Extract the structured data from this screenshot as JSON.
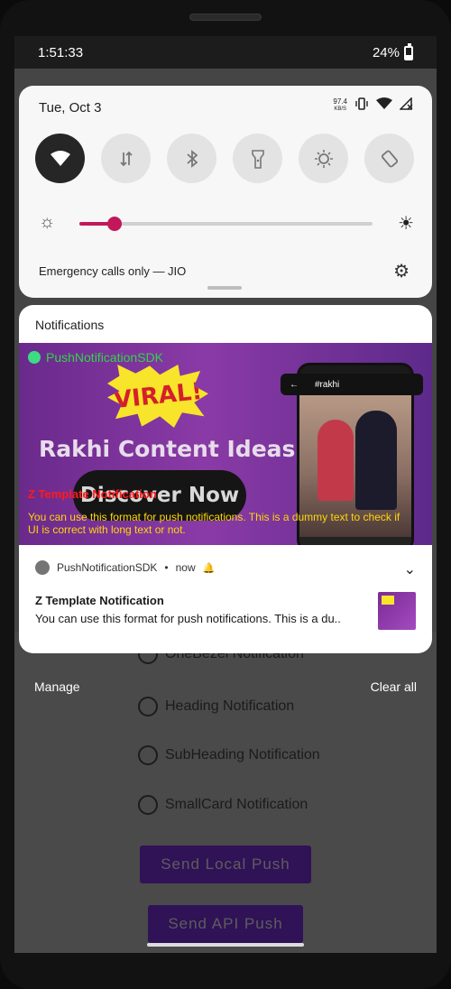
{
  "statusbar": {
    "time": "1:51:33",
    "battery": "24%"
  },
  "quick_settings": {
    "date": "Tue, Oct 3",
    "net_speed_value": "97.4",
    "net_speed_unit": "KB/S",
    "brightness_level": 0.12,
    "carrier": "Emergency calls only — JIO"
  },
  "notifications": {
    "header": "Notifications",
    "banner": {
      "app_name": "PushNotificationSDK",
      "viral_text": "VIRAL!",
      "headline": "Rakhi Content Ideas",
      "cta": "Discover Now",
      "hashtag": "#rakhi",
      "overlay_title": "Z Template Notification",
      "overlay_body": "You can use this format for push notifications. This is a dummy text to check if UI is correct with long text or not."
    },
    "item": {
      "app_name": "PushNotificationSDK",
      "time": "now",
      "title": "Z Template Notification",
      "body": "You can use this format for push notifications. This is a du.."
    },
    "manage": "Manage",
    "clear_all": "Clear all"
  },
  "background_app": {
    "options": [
      "OneBezel Notification",
      "Heading Notification",
      "SubHeading Notification",
      "SmallCard Notification"
    ],
    "send_local": "Send Local Push",
    "send_api": "Send API Push"
  },
  "colors": {
    "accent": "#c2185b",
    "brand_purple": "#4b1d86"
  }
}
